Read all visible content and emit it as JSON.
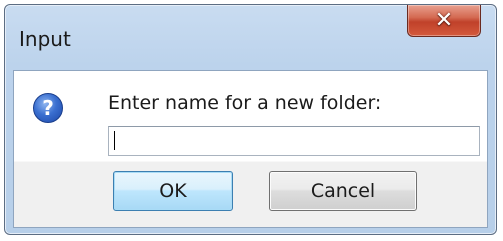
{
  "dialog": {
    "title": "Input",
    "close_icon": "close-icon",
    "prompt_icon": "question-icon",
    "prompt_label": "Enter name for a new folder:",
    "input_value": "",
    "input_placeholder": "",
    "ok_label": "OK",
    "cancel_label": "Cancel"
  },
  "colors": {
    "close_button": "#c0412a",
    "ok_button": "#bee6fd",
    "question_icon": "#3a6fd0"
  }
}
